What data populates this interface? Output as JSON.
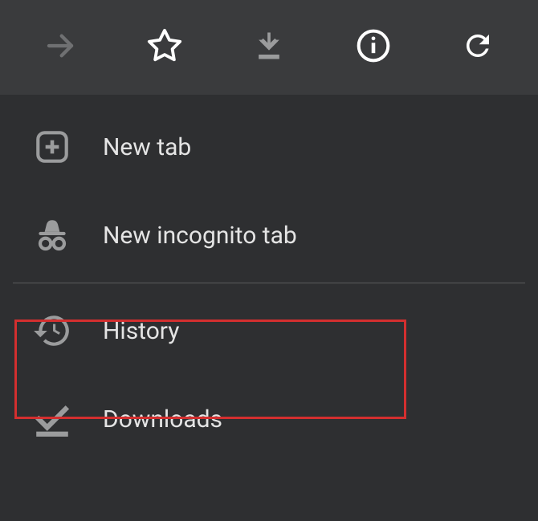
{
  "toolbar": {
    "forward": "Forward",
    "bookmark": "Bookmark",
    "download": "Download",
    "info": "Page info",
    "reload": "Reload"
  },
  "menu": {
    "new_tab": "New tab",
    "new_incognito_tab": "New incognito tab",
    "history": "History",
    "downloads": "Downloads"
  }
}
